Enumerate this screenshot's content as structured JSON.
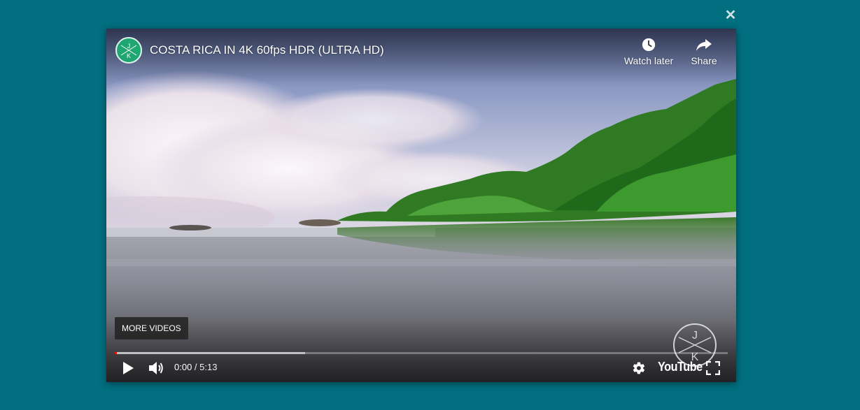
{
  "modal": {
    "close_symbol": "✕"
  },
  "video": {
    "title": "COSTA RICA IN 4K 60fps HDR (ULTRA HD)",
    "channel_logo_letters": [
      "J",
      "K"
    ],
    "current_time": "0:00",
    "separator": " / ",
    "duration": "5:13",
    "played_fraction": 0.003,
    "buffered_fraction": 0.31
  },
  "top_actions": {
    "watch_later": {
      "label": "Watch later",
      "icon": "clock-icon"
    },
    "share": {
      "label": "Share",
      "icon": "share-arrow-icon"
    }
  },
  "overlay": {
    "more_videos_label": "MORE VIDEOS"
  },
  "controls": {
    "play_icon": "play-icon",
    "volume_icon": "volume-icon",
    "settings_icon": "gear-icon",
    "fullscreen_icon": "fullscreen-icon",
    "brand": "YouTube"
  },
  "colors": {
    "page_background": "#016f80",
    "progress_played": "#ff0000",
    "channel_logo": "#1fa672"
  }
}
